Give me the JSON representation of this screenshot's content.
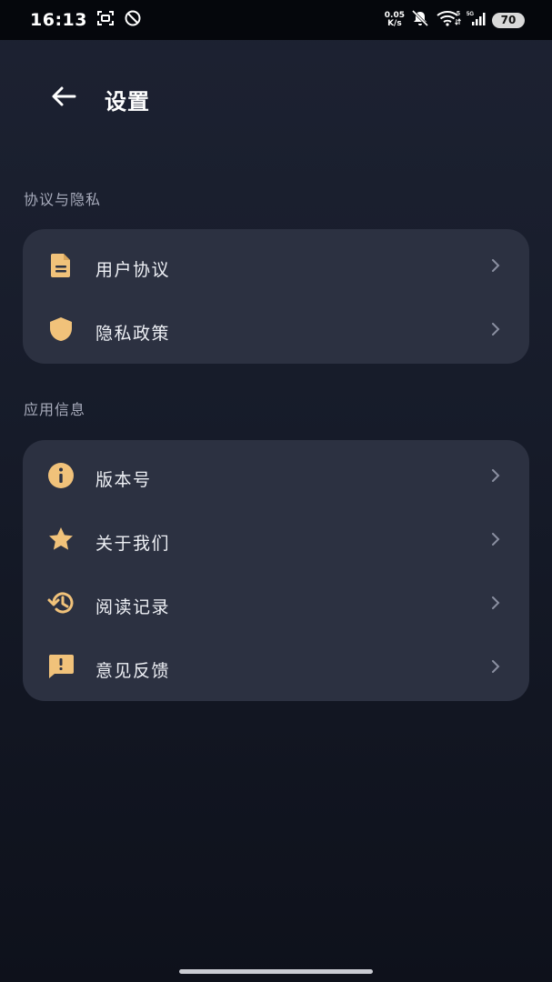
{
  "status_bar": {
    "time": "16:13",
    "net_speed_value": "0.05",
    "net_speed_unit": "K/s",
    "battery": "70"
  },
  "header": {
    "title": "设置"
  },
  "sections": [
    {
      "title": "协议与隐私",
      "items": [
        {
          "label": "用户协议",
          "icon": "document-icon"
        },
        {
          "label": "隐私政策",
          "icon": "shield-icon"
        }
      ]
    },
    {
      "title": "应用信息",
      "items": [
        {
          "label": "版本号",
          "icon": "info-icon"
        },
        {
          "label": "关于我们",
          "icon": "star-icon"
        },
        {
          "label": "阅读记录",
          "icon": "history-icon"
        },
        {
          "label": "意见反馈",
          "icon": "feedback-icon"
        }
      ]
    }
  ],
  "colors": {
    "accent_icon": "#f1c27a",
    "card_bg": "#2c3141",
    "background": "#161b29"
  }
}
